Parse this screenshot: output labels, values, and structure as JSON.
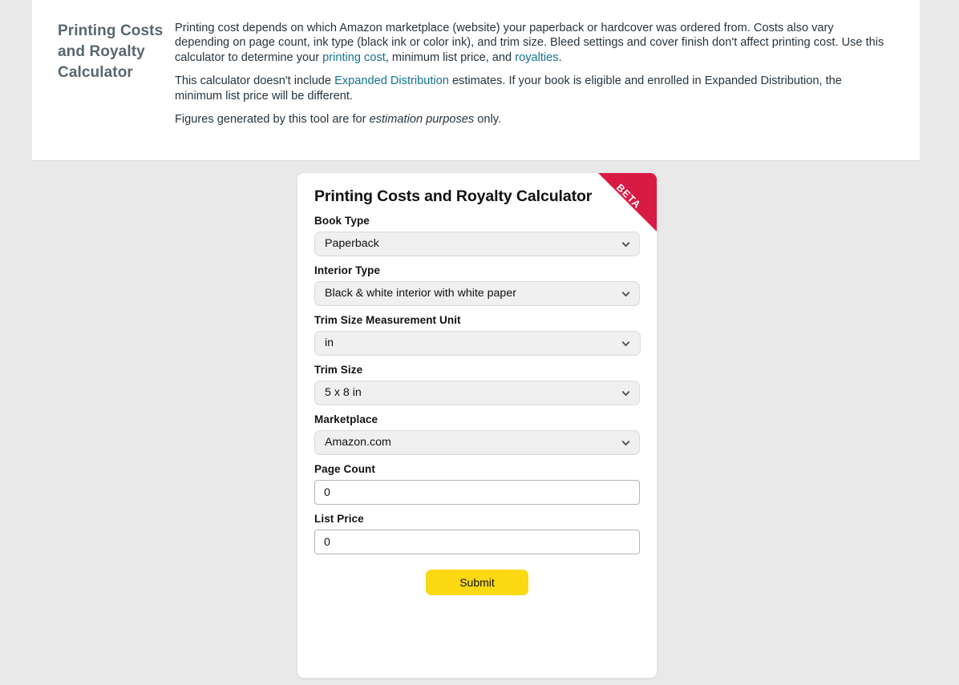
{
  "intro": {
    "heading": "Printing Costs and Royalty Calculator",
    "paragraph1": {
      "seg1": "Printing cost depends on which Amazon marketplace (website) your paperback or hardcover was ordered from. Costs also vary depending on page count, ink type (black ink or color ink), and trim size. Bleed settings and cover finish don't affect printing cost. Use this calculator to determine your ",
      "link1": "printing cost",
      "seg2": ", minimum list price, and ",
      "link2": "royalties",
      "seg3": "."
    },
    "paragraph2": {
      "seg1": "This calculator doesn't include ",
      "link1": "Expanded Distribution",
      "seg2": " estimates. If your book is eligible and enrolled in Expanded Distribution, the minimum list price will be different."
    },
    "paragraph3": {
      "seg1": "Figures generated by this tool are for ",
      "em1": "estimation purposes",
      "seg2": " only."
    }
  },
  "card": {
    "title": "Printing Costs and Royalty Calculator",
    "ribbon": "BETA",
    "fields": [
      {
        "label": "Book Type",
        "value": "Paperback",
        "control": "select",
        "icon": "chevron-down-icon"
      },
      {
        "label": "Interior Type",
        "value": "Black & white interior with white paper",
        "control": "select",
        "icon": "chevron-down-icon"
      },
      {
        "label": "Trim Size Measurement Unit",
        "value": "in",
        "control": "select",
        "icon": "chevron-down-icon"
      },
      {
        "label": "Trim Size",
        "value": "5 x 8 in",
        "control": "select",
        "icon": "chevron-down-icon"
      },
      {
        "label": "Marketplace",
        "value": "Amazon.com",
        "control": "select",
        "icon": "chevron-down-icon"
      },
      {
        "label": "Page Count",
        "value": "0",
        "control": "input"
      },
      {
        "label": "List Price",
        "value": "0",
        "control": "input"
      }
    ],
    "submit_label": "Submit"
  },
  "colors": {
    "page_background": "#e9e9e9",
    "panel_background": "#ffffff",
    "link": "#14728d",
    "heading": "#59676f",
    "ribbon_red": "#d81b43",
    "submit_yellow": "#fcd913",
    "select_fill": "#f0f0f0"
  }
}
